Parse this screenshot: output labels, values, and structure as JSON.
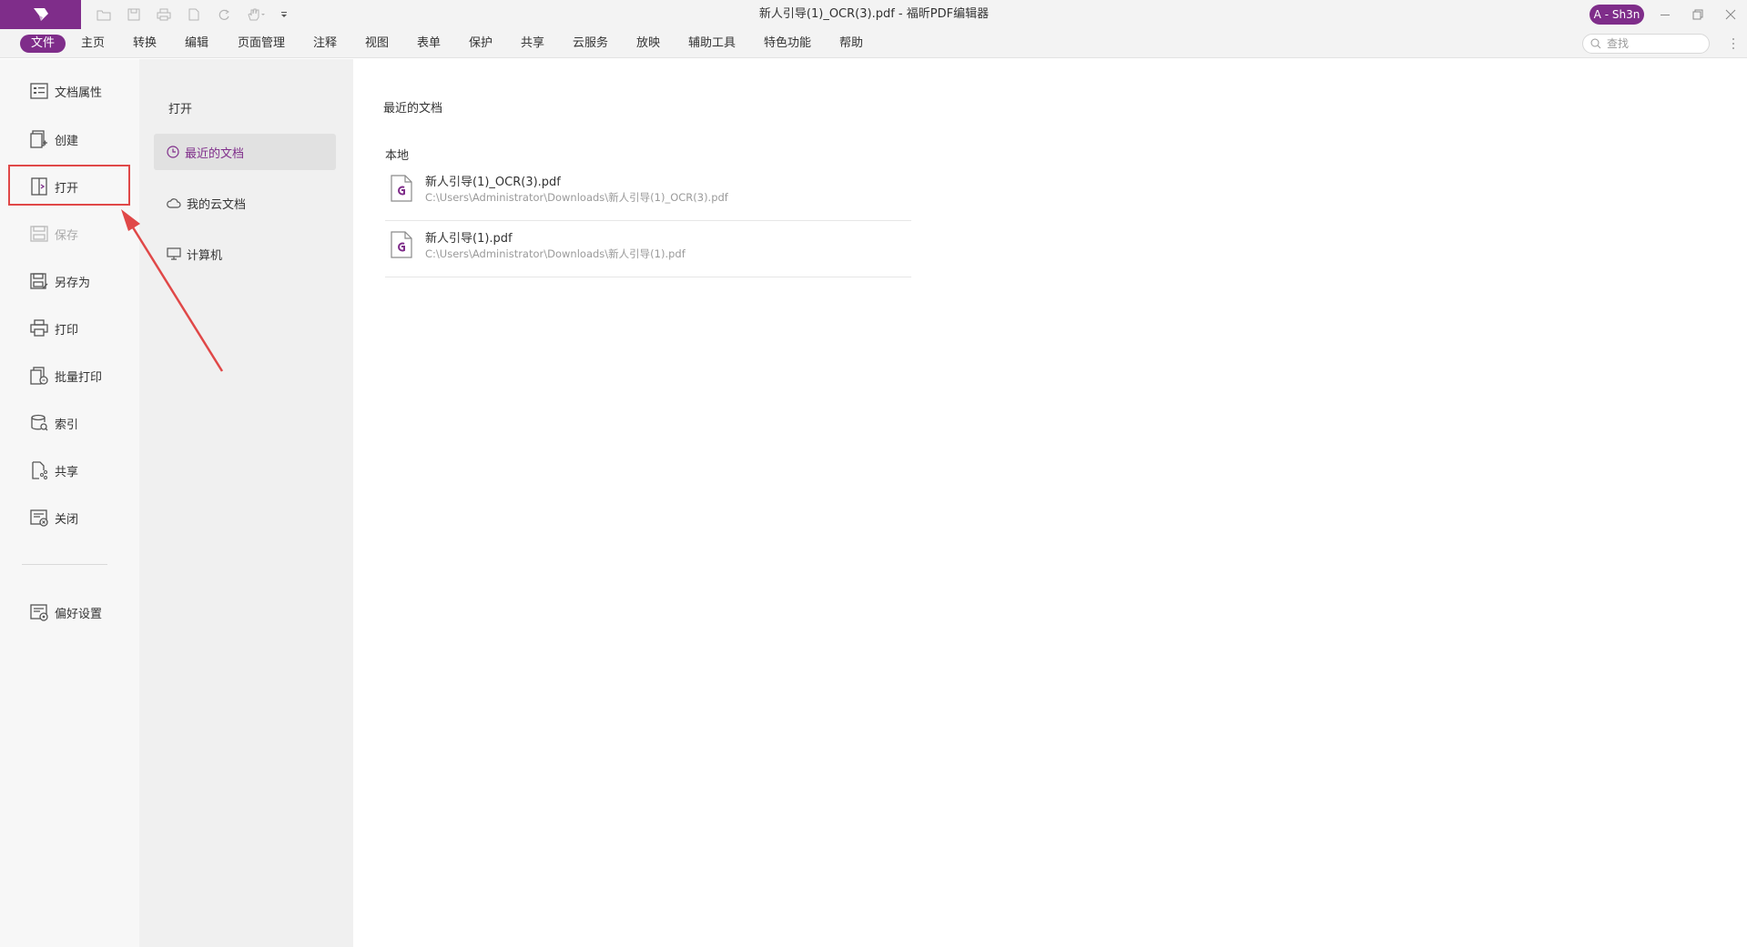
{
  "window": {
    "title": "新人引导(1)_OCR(3).pdf - 福昕PDF编辑器",
    "user_badge": "A - Sh3n"
  },
  "quick_access": [
    "open-folder-icon",
    "save-icon",
    "print-icon",
    "new-doc-icon",
    "redo-icon",
    "hand-tool-icon",
    "customize-dropdown-icon"
  ],
  "menu": {
    "items": [
      "文件",
      "主页",
      "转换",
      "编辑",
      "页面管理",
      "注释",
      "视图",
      "表单",
      "保护",
      "共享",
      "云服务",
      "放映",
      "辅助工具",
      "特色功能",
      "帮助"
    ],
    "active_index": 0
  },
  "search": {
    "placeholder": "查找"
  },
  "left_nav": {
    "items": [
      {
        "label": "文档属性",
        "icon": "document-properties-icon"
      },
      {
        "label": "创建",
        "icon": "create-icon"
      },
      {
        "label": "打开",
        "icon": "open-icon"
      },
      {
        "label": "保存",
        "icon": "save-icon",
        "disabled": true
      },
      {
        "label": "另存为",
        "icon": "save-as-icon"
      },
      {
        "label": "打印",
        "icon": "print-icon"
      },
      {
        "label": "批量打印",
        "icon": "batch-print-icon"
      },
      {
        "label": "索引",
        "icon": "index-icon"
      },
      {
        "label": "共享",
        "icon": "share-icon"
      },
      {
        "label": "关闭",
        "icon": "close-doc-icon"
      }
    ],
    "preferences": {
      "label": "偏好设置",
      "icon": "preferences-icon"
    }
  },
  "open_panel": {
    "title": "打开",
    "items": [
      {
        "label": "最近的文档",
        "icon": "clock-icon",
        "selected": true
      },
      {
        "label": "我的云文档",
        "icon": "cloud-icon"
      },
      {
        "label": "计算机",
        "icon": "computer-icon"
      }
    ]
  },
  "content": {
    "title": "最近的文档",
    "section": "本地",
    "files": [
      {
        "name": "新人引导(1)_OCR(3).pdf",
        "path": "C:\\Users\\Administrator\\Downloads\\新人引导(1)_OCR(3).pdf"
      },
      {
        "name": "新人引导(1).pdf",
        "path": "C:\\Users\\Administrator\\Downloads\\新人引导(1).pdf"
      }
    ]
  },
  "colors": {
    "brand": "#7f2d8a",
    "annotation": "#e04848"
  }
}
